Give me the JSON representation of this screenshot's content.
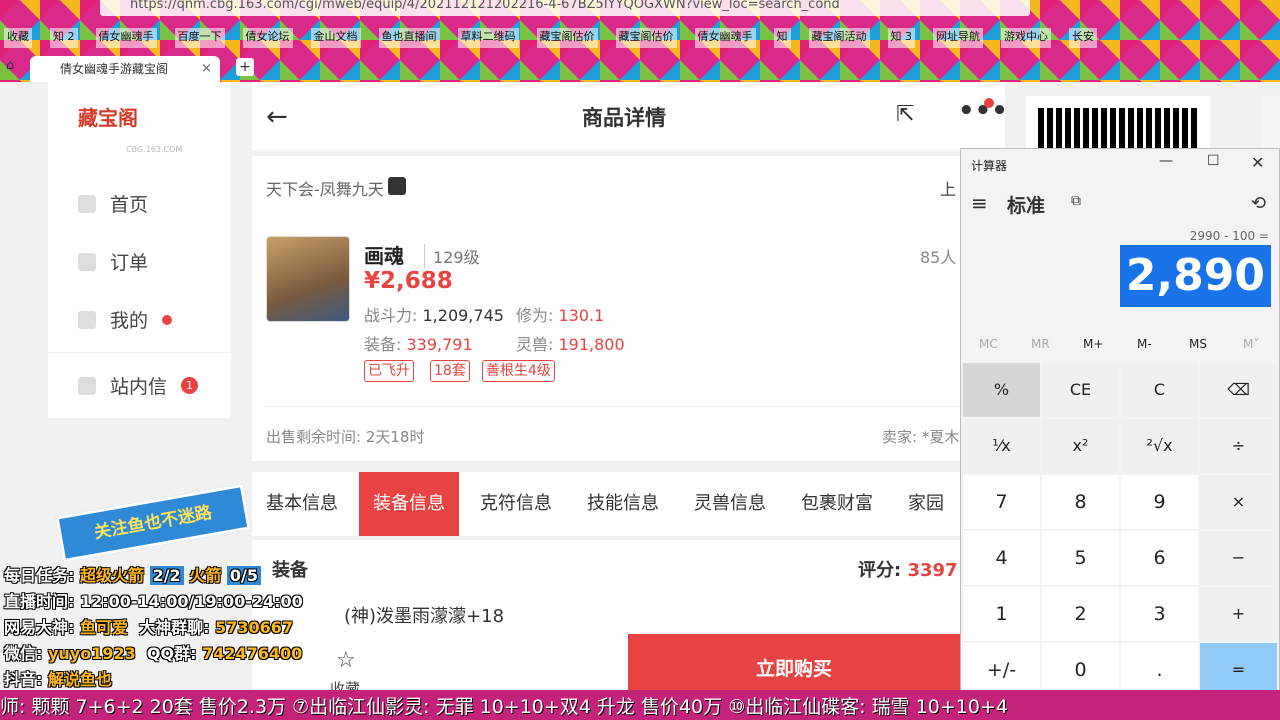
{
  "browser": {
    "url": "https://qnm.cbg.163.com/cgi/mweb/equip/4/202112121202216-4-67BZ5IYYQOGXWN?view_loc=search_cond",
    "bookmarks": [
      "收藏",
      "知 2",
      "倩女幽魂手",
      "百度一下",
      "倩女论坛",
      "金山文档",
      "鱼也直播间",
      "草料二维码",
      "藏宝阁估价",
      "藏宝阁估价",
      "倩女幽魂手",
      "知",
      "藏宝阁活动",
      "知 3",
      "网址导航",
      "游戏中心",
      "长安"
    ],
    "tab_title": "倩女幽魂手游藏宝阁",
    "tab_close": "×",
    "new_tab": "+"
  },
  "sidebar": {
    "logo": "藏宝阁",
    "logo_sub": "CBG.163.COM",
    "items": [
      {
        "label": "首页"
      },
      {
        "label": "订单"
      },
      {
        "label": "我的"
      },
      {
        "label": "站内信",
        "badge": "1"
      }
    ]
  },
  "header": {
    "back": "←",
    "title": "商品详情",
    "share": "⇱",
    "more": "•••"
  },
  "card": {
    "server": "天下会-凤舞九天",
    "server_icon": "",
    "right_label": "上",
    "character": {
      "name": "画魂",
      "level": "129级",
      "price": "¥2,688",
      "views": "85人",
      "power_label": "战斗力:",
      "power": "1,209,745",
      "cultivation_label": "修为:",
      "cultivation": "130.1",
      "equip_label": "装备:",
      "equip": "339,791",
      "pet_label": "灵兽:",
      "pet": "191,800",
      "tags": [
        "已飞升",
        "18套",
        "善根生4级"
      ]
    },
    "remain": "出售剩余时间: 2天18时",
    "seller": "卖家: *夏木"
  },
  "tabs": [
    "基本信息",
    "装备信息",
    "克符信息",
    "技能信息",
    "灵兽信息",
    "包裹财富",
    "家园信"
  ],
  "content": {
    "score_label": "评分:",
    "score": "3397",
    "section": "装备",
    "item": "(神)泼墨雨濛濛+18"
  },
  "bottom": {
    "fav_icon": "☆",
    "fav": "收藏",
    "buy": "立即购买"
  },
  "calculator": {
    "title": "计算器",
    "min": "—",
    "max": "☐",
    "close": "✕",
    "menu": "≡",
    "mode": "标准",
    "keep": "⧉",
    "history": "⟲",
    "expression": "2990 - 100 =",
    "display": "2,890",
    "memory": [
      "MC",
      "MR",
      "M+",
      "M-",
      "MS",
      "M˅"
    ],
    "keys": [
      "%",
      "CE",
      "C",
      "⌫",
      "¹⁄x",
      "x²",
      "²√x",
      "÷",
      "7",
      "8",
      "9",
      "×",
      "4",
      "5",
      "6",
      "−",
      "1",
      "2",
      "3",
      "+",
      "+/-",
      "0",
      ".",
      "="
    ]
  },
  "overlay": {
    "banner": "关注鱼也不迷路",
    "task_label": "每日任务:",
    "task1": "超级火箭",
    "task1_count": "2/2",
    "task2": "火箭",
    "task2_count": "0/5",
    "live_time": "直播时间: 12:00-14:00/19:00-24:00",
    "netease_label": "网易大神:",
    "netease": "鱼可爱",
    "group_label": "大神群聊:",
    "group": "5730667",
    "wechat_label": "微信:",
    "wechat": "yuyo1923",
    "qq_label": "QQ群:",
    "qq": "742476400",
    "douyin_label": "抖音:",
    "douyin": "解说鱼也",
    "ticker": "师: 颗颗 7+6+2 20套 售价2.3万  ⑦出临江仙影灵: 无罪 10+10+双4 升龙 售价40万   ⑩出临江仙碟客: 瑞雪 10+10+4"
  }
}
